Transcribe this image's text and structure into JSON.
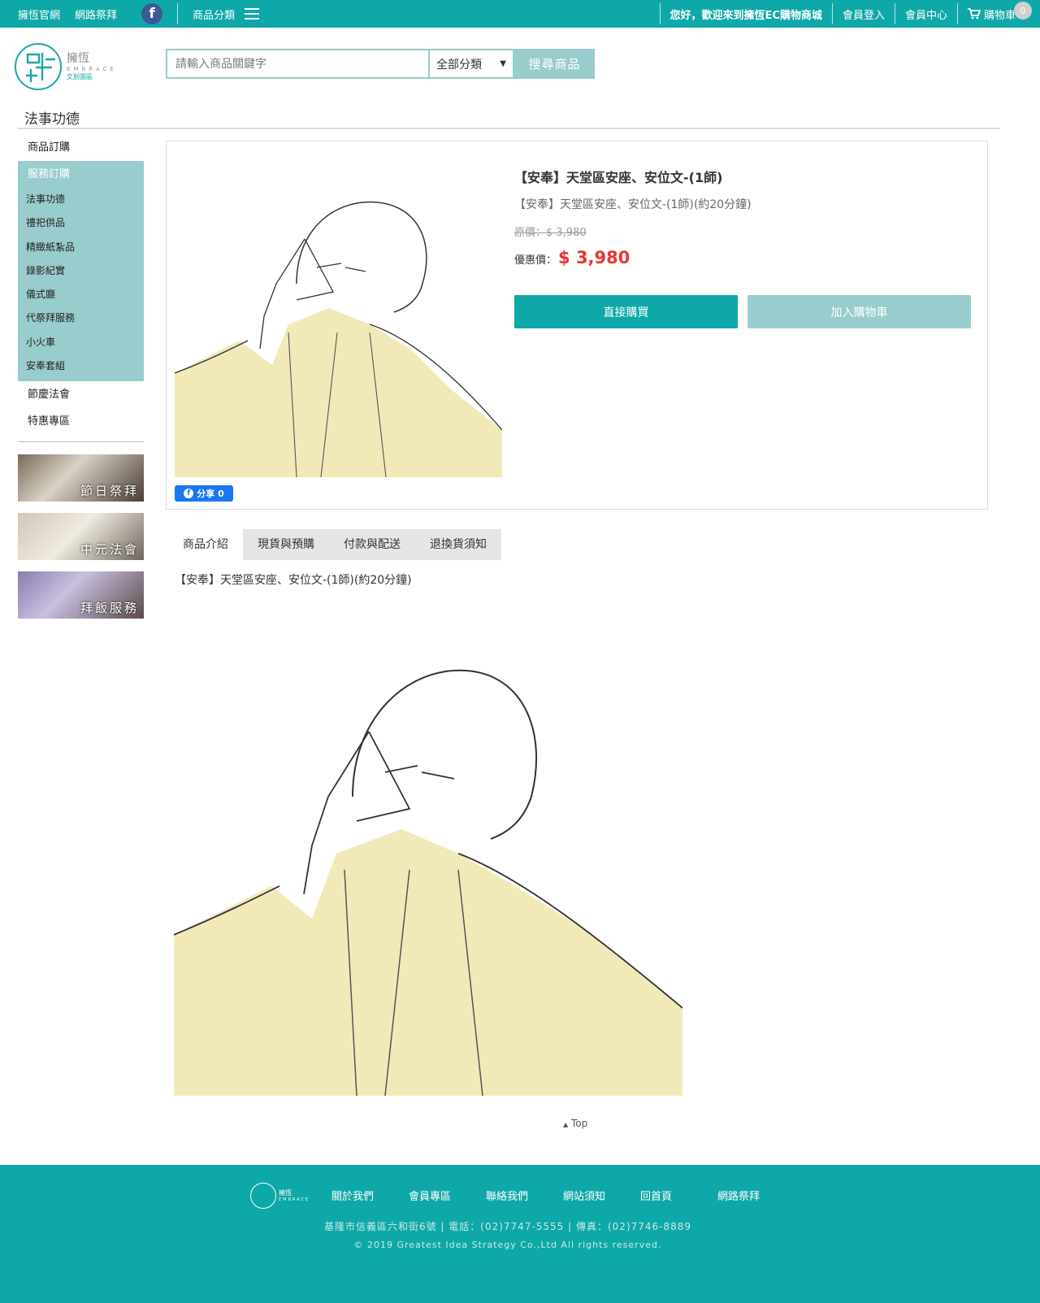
{
  "topbar": {
    "links": [
      "擁恆官網",
      "網路祭拜"
    ],
    "category_label": "商品分類",
    "welcome": "您好，歡迎來到擁恆EC購物商城",
    "login": "會員登入",
    "member_center": "會員中心",
    "cart": "購物車",
    "cart_count": "0",
    "facebook": "f"
  },
  "logo": {
    "name": "擁恆",
    "sub": "EMBRACE",
    "tag": "文創園區"
  },
  "search": {
    "placeholder": "請輸入商品關鍵字",
    "category": "全部分類",
    "button": "搜尋商品"
  },
  "page_title": "法事功德",
  "sidebar": {
    "top": "商品訂購",
    "group": "服務訂購",
    "items": [
      "法事功德",
      "禮祀供品",
      "精緻紙紮品",
      "錄影紀實",
      "儀式廳",
      "代祭拜服務",
      "小火車",
      "安奉套組"
    ],
    "after": [
      "節慶法會",
      "特惠專區"
    ],
    "banners": [
      "節日祭拜",
      "中元法會",
      "拜飯服務"
    ]
  },
  "product": {
    "title": "【安奉】天堂區安座、安位文-(1師)",
    "subtitle": "【安奉】天堂區安座、安位文-(1師)(約20分鐘)",
    "original_price": "原價：$ 3,980",
    "sale_label": "優惠價：",
    "sale_price": "$ 3,980",
    "buy_now": "直接購買",
    "add_cart": "加入購物車",
    "share": "分享 0"
  },
  "tabs": [
    "商品介紹",
    "現貨與預購",
    "付款與配送",
    "退換貨須知"
  ],
  "description": "【安奉】天堂區安座、安位文-(1師)(約20分鐘)",
  "to_top": "Top",
  "footer": {
    "nav": [
      "關於我們",
      "會員專區",
      "聯絡我們",
      "網站須知",
      "回首頁",
      "網路祭拜"
    ],
    "address": "基隆市信義區六和街6號  |  電話：(02)7747-5555  |  傳真：(02)7746-8889",
    "copyright": "© 2019 Greatest Idea Strategy Co.,Ltd All rights reserved."
  },
  "colors": {
    "teal": "#0fa8a8",
    "light_teal": "#99cccc",
    "price_red": "#e33333"
  }
}
